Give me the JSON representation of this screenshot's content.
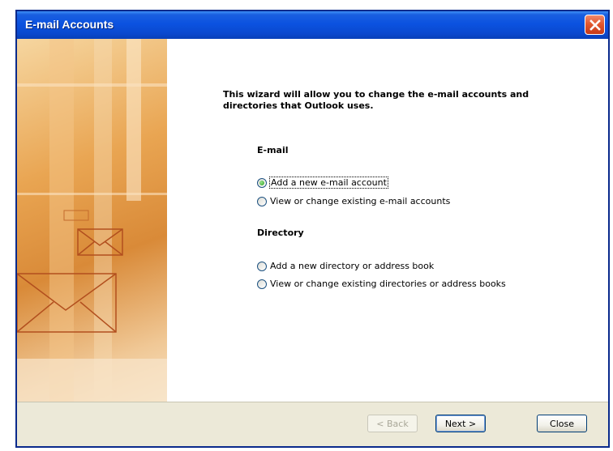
{
  "window": {
    "title": "E-mail Accounts"
  },
  "intro_text": "This wizard will allow you to change the e-mail accounts and directories that Outlook uses.",
  "email_section": {
    "heading": "E-mail",
    "options": [
      {
        "label": "Add a new e-mail account",
        "selected": true
      },
      {
        "label": "View or change existing e-mail accounts",
        "selected": false
      }
    ]
  },
  "directory_section": {
    "heading": "Directory",
    "options": [
      {
        "label": "Add a new directory or address book",
        "selected": false
      },
      {
        "label": "View or change existing directories or address books",
        "selected": false
      }
    ]
  },
  "buttons": {
    "back": "< Back",
    "next": "Next >",
    "close": "Close"
  },
  "icons": {
    "close": "close-x-icon",
    "art": "envelope-illustration"
  },
  "colors": {
    "titlebar": "#0b52e0",
    "close_button": "#e2582f",
    "dialog_face": "#ece9d8"
  }
}
